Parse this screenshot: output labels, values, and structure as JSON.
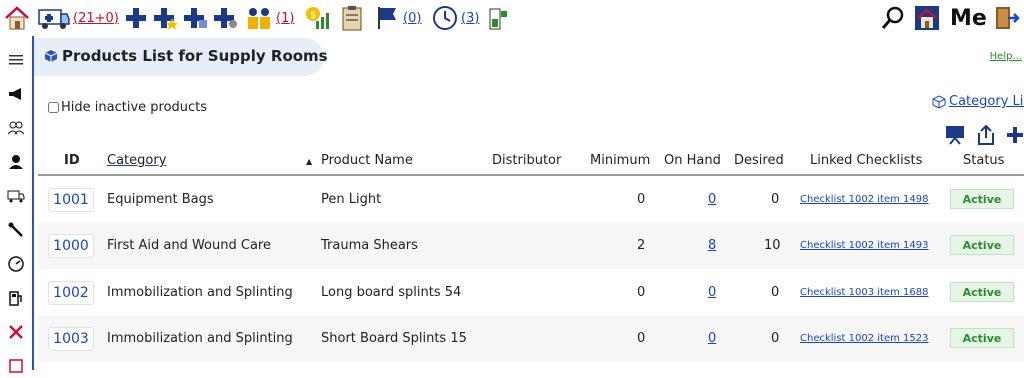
{
  "toolbar": {
    "ambulance_count": "(21+0)",
    "staff_count": "(1)",
    "flag_count": "(0)",
    "clock_count": "(3)",
    "me_label": "Me"
  },
  "header": {
    "title": "Products List for Supply Rooms",
    "help": "Help...",
    "hide_inactive_label": "Hide inactive products",
    "category_list_link": "Category List"
  },
  "table": {
    "columns": {
      "id": "ID",
      "category": "Category",
      "product_name": "Product Name",
      "distributor": "Distributor",
      "minimum": "Minimum",
      "on_hand": "On Hand",
      "desired": "Desired",
      "linked_checklists": "Linked Checklists",
      "status": "Status"
    },
    "rows": [
      {
        "id": "1001",
        "category": "Equipment Bags",
        "product": "Pen Light",
        "distributor": "",
        "minimum": "0",
        "on_hand": "0",
        "desired": "0",
        "checklist": "Checklist 1002 item 1498",
        "status": "Active"
      },
      {
        "id": "1000",
        "category": "First Aid and Wound Care",
        "product": "Trauma Shears",
        "distributor": "",
        "minimum": "2",
        "on_hand": "8",
        "desired": "10",
        "checklist": "Checklist 1002 item 1493",
        "status": "Active"
      },
      {
        "id": "1002",
        "category": "Immobilization and Splinting",
        "product": "Long board splints 54",
        "distributor": "",
        "minimum": "0",
        "on_hand": "0",
        "desired": "0",
        "checklist": "Checklist 1003 item 1688",
        "status": "Active"
      },
      {
        "id": "1003",
        "category": "Immobilization and Splinting",
        "product": "Short Board Splints 15",
        "distributor": "",
        "minimum": "0",
        "on_hand": "0",
        "desired": "0",
        "checklist": "Checklist 1002 item 1523",
        "status": "Active"
      }
    ]
  },
  "colors": {
    "accent_blue": "#1a44c8",
    "nav_border": "#2a55b8",
    "status_green": "#2e8b2e",
    "alert_red": "#c8102e"
  }
}
